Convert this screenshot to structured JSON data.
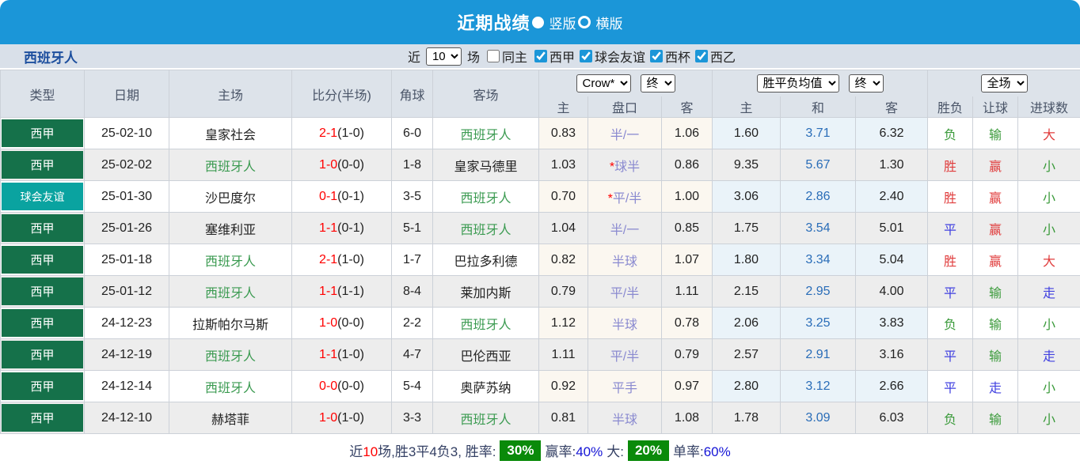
{
  "title_bar": {
    "title": "近期战绩",
    "radio_vertical": "竖版",
    "radio_horizontal": "横版"
  },
  "filter": {
    "team": "西班牙人",
    "near_label": "近",
    "count": "10",
    "games_label": "场",
    "same_home_label": "同主",
    "leagues": [
      "西甲",
      "球会友谊",
      "西杯",
      "西乙"
    ]
  },
  "table": {
    "selects": {
      "odds_company": "Crow*",
      "odds_stage": "终",
      "avg_type": "胜平负均值",
      "avg_stage": "终",
      "scope": "全场"
    },
    "columns": {
      "type": "类型",
      "date": "日期",
      "home": "主场",
      "score": "比分(半场)",
      "corner": "角球",
      "away": "客场",
      "odds_home": "主",
      "handicap": "盘口",
      "odds_away": "客",
      "avg_home": "主",
      "avg_draw": "和",
      "avg_away": "客",
      "result": "胜负",
      "handicap_result": "让球",
      "goals": "进球数"
    },
    "rows": [
      {
        "type": "西甲",
        "date": "25-02-10",
        "home": "皇家社会",
        "score": "2-1",
        "half": "(1-0)",
        "corner": "6-0",
        "away": "西班牙人",
        "odds_home": "0.83",
        "handicap": "半/一",
        "odds_away": "1.06",
        "avg_home": "1.60",
        "avg_draw": "3.71",
        "avg_away": "6.32",
        "result": "负",
        "handicap_result": "输",
        "goals": "大"
      },
      {
        "type": "西甲",
        "date": "25-02-02",
        "home": "西班牙人",
        "score": "1-0",
        "half": "(0-0)",
        "corner": "1-8",
        "away": "皇家马德里",
        "odds_home": "1.03",
        "handicap": "*球半",
        "odds_away": "0.86",
        "avg_home": "9.35",
        "avg_draw": "5.67",
        "avg_away": "1.30",
        "result": "胜",
        "handicap_result": "赢",
        "goals": "小"
      },
      {
        "type": "球会友谊",
        "date": "25-01-30",
        "home": "沙巴度尔",
        "score": "0-1",
        "half": "(0-1)",
        "corner": "3-5",
        "away": "西班牙人",
        "odds_home": "0.70",
        "handicap": "*平/半",
        "odds_away": "1.00",
        "avg_home": "3.06",
        "avg_draw": "2.86",
        "avg_away": "2.40",
        "result": "胜",
        "handicap_result": "赢",
        "goals": "小"
      },
      {
        "type": "西甲",
        "date": "25-01-26",
        "home": "塞维利亚",
        "score": "1-1",
        "half": "(0-1)",
        "corner": "5-1",
        "away": "西班牙人",
        "odds_home": "1.04",
        "handicap": "半/一",
        "odds_away": "0.85",
        "avg_home": "1.75",
        "avg_draw": "3.54",
        "avg_away": "5.01",
        "result": "平",
        "handicap_result": "赢",
        "goals": "小"
      },
      {
        "type": "西甲",
        "date": "25-01-18",
        "home": "西班牙人",
        "score": "2-1",
        "half": "(1-0)",
        "corner": "1-7",
        "away": "巴拉多利德",
        "odds_home": "0.82",
        "handicap": "半球",
        "odds_away": "1.07",
        "avg_home": "1.80",
        "avg_draw": "3.34",
        "avg_away": "5.04",
        "result": "胜",
        "handicap_result": "赢",
        "goals": "大"
      },
      {
        "type": "西甲",
        "date": "25-01-12",
        "home": "西班牙人",
        "score": "1-1",
        "half": "(1-1)",
        "corner": "8-4",
        "away": "莱加内斯",
        "odds_home": "0.79",
        "handicap": "平/半",
        "odds_away": "1.11",
        "avg_home": "2.15",
        "avg_draw": "2.95",
        "avg_away": "4.00",
        "result": "平",
        "handicap_result": "输",
        "goals": "走"
      },
      {
        "type": "西甲",
        "date": "24-12-23",
        "home": "拉斯帕尔马斯",
        "score": "1-0",
        "half": "(0-0)",
        "corner": "2-2",
        "away": "西班牙人",
        "odds_home": "1.12",
        "handicap": "半球",
        "odds_away": "0.78",
        "avg_home": "2.06",
        "avg_draw": "3.25",
        "avg_away": "3.83",
        "result": "负",
        "handicap_result": "输",
        "goals": "小"
      },
      {
        "type": "西甲",
        "date": "24-12-19",
        "home": "西班牙人",
        "score": "1-1",
        "half": "(1-0)",
        "corner": "4-7",
        "away": "巴伦西亚",
        "odds_home": "1.11",
        "handicap": "平/半",
        "odds_away": "0.79",
        "avg_home": "2.57",
        "avg_draw": "2.91",
        "avg_away": "3.16",
        "result": "平",
        "handicap_result": "输",
        "goals": "走"
      },
      {
        "type": "西甲",
        "date": "24-12-14",
        "home": "西班牙人",
        "score": "0-0",
        "half": "(0-0)",
        "corner": "5-4",
        "away": "奥萨苏纳",
        "odds_home": "0.92",
        "handicap": "平手",
        "odds_away": "0.97",
        "avg_home": "2.80",
        "avg_draw": "3.12",
        "avg_away": "2.66",
        "result": "平",
        "handicap_result": "走",
        "goals": "小"
      },
      {
        "type": "西甲",
        "date": "24-12-10",
        "home": "赫塔菲",
        "score": "1-0",
        "half": "(1-0)",
        "corner": "3-3",
        "away": "西班牙人",
        "odds_home": "0.81",
        "handicap": "半球",
        "odds_away": "1.08",
        "avg_home": "1.78",
        "avg_draw": "3.09",
        "avg_away": "6.03",
        "result": "负",
        "handicap_result": "输",
        "goals": "小"
      }
    ]
  },
  "summary": {
    "prefix": "近",
    "count": "10",
    "record": "场,胜3平4负3, 胜率:",
    "win_rate": "30%",
    "handicap_label": "赢率:",
    "handicap_rate": "40%",
    "big_label": "大:",
    "big_rate": "20%",
    "single_label": "单率:",
    "single_rate": "60%"
  }
}
